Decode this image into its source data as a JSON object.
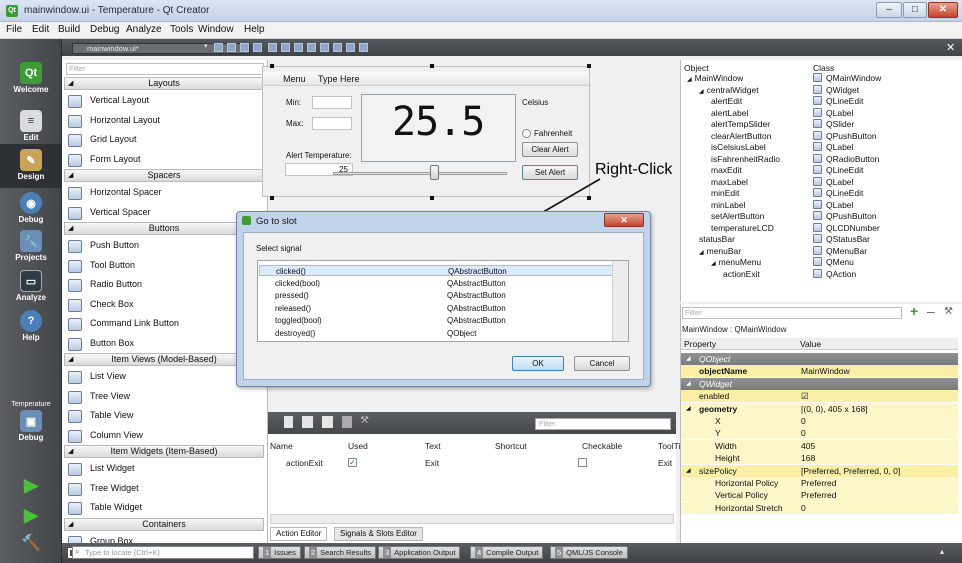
{
  "window": {
    "title": "mainwindow.ui - Temperature - Qt Creator",
    "icon": "qt-creator-icon"
  },
  "menubar": [
    "File",
    "Edit",
    "Build",
    "Debug",
    "Analyze",
    "Tools",
    "Window",
    "Help"
  ],
  "modes": [
    {
      "label": "Welcome",
      "icon": "qt-logo-icon"
    },
    {
      "label": "Edit",
      "icon": "edit-document-icon"
    },
    {
      "label": "Design",
      "icon": "design-pen-icon"
    },
    {
      "label": "Debug",
      "icon": "debug-icon"
    },
    {
      "label": "Projects",
      "icon": "projects-wrench-icon"
    },
    {
      "label": "Analyze",
      "icon": "analyze-monitor-icon"
    },
    {
      "label": "Help",
      "icon": "help-icon"
    },
    {
      "label": "Temperature",
      "icon": "kit-selector-icon"
    },
    {
      "label": "Debug",
      "icon": "build-config-icon"
    }
  ],
  "editor": {
    "file": "mainwindow.ui*"
  },
  "widgetbox": {
    "filter_placeholder": "Filter",
    "sections": [
      {
        "title": "Layouts",
        "items": [
          "Vertical Layout",
          "Horizontal Layout",
          "Grid Layout",
          "Form Layout"
        ]
      },
      {
        "title": "Spacers",
        "items": [
          "Horizontal Spacer",
          "Vertical Spacer"
        ]
      },
      {
        "title": "Buttons",
        "items": [
          "Push Button",
          "Tool Button",
          "Radio Button",
          "Check Box",
          "Command Link Button",
          "Button Box"
        ]
      },
      {
        "title": "Item Views (Model-Based)",
        "items": [
          "List View",
          "Tree View",
          "Table View",
          "Column View"
        ]
      },
      {
        "title": "Item Widgets (Item-Based)",
        "items": [
          "List Widget",
          "Tree Widget",
          "Table Widget"
        ]
      },
      {
        "title": "Containers",
        "items": [
          "Group Box",
          "Scroll Area"
        ]
      }
    ]
  },
  "form": {
    "menu": [
      "Menu",
      "Type Here"
    ],
    "min_label": "Min:",
    "max_label": "Max:",
    "alert_label": "Alert Temperature:",
    "alert_value": "25",
    "lcd_value": "25.5",
    "celsius_label": "Celsius",
    "fahrenheit_label": "Fahrenheit",
    "clear_alert": "Clear Alert",
    "set_alert": "Set Alert",
    "slider_fraction": 0.58
  },
  "callout": "Right-Click",
  "dialog": {
    "title": "Go to slot",
    "select_signal": "Select signal",
    "signals": [
      {
        "name": "clicked()",
        "class": "QAbstractButton",
        "selected": true
      },
      {
        "name": "clicked(bool)",
        "class": "QAbstractButton"
      },
      {
        "name": "pressed()",
        "class": "QAbstractButton"
      },
      {
        "name": "released()",
        "class": "QAbstractButton"
      },
      {
        "name": "toggled(bool)",
        "class": "QAbstractButton"
      },
      {
        "name": "destroyed()",
        "class": "QObject"
      }
    ],
    "ok": "OK",
    "cancel": "Cancel"
  },
  "action_editor": {
    "filter_placeholder": "Filter",
    "headers": [
      "Name",
      "Used",
      "Text",
      "Shortcut",
      "Checkable",
      "ToolTi"
    ],
    "rows": [
      {
        "name": "actionExit",
        "used": true,
        "text": "Exit",
        "shortcut": "",
        "checkable": false,
        "tooltip": "Exit"
      }
    ],
    "tabs": [
      "Action Editor",
      "Signals & Slots Editor"
    ]
  },
  "object_inspector": {
    "headers": [
      "Object",
      "Class"
    ],
    "rows": [
      {
        "name": "MainWindow",
        "class": "QMainWindow",
        "depth": 0,
        "expand": true
      },
      {
        "name": "centralWidget",
        "class": "QWidget",
        "depth": 1,
        "expand": true
      },
      {
        "name": "alertEdit",
        "class": "QLineEdit",
        "depth": 2
      },
      {
        "name": "alertLabel",
        "class": "QLabel",
        "depth": 2
      },
      {
        "name": "alertTempSlider",
        "class": "QSlider",
        "depth": 2
      },
      {
        "name": "clearAlertButton",
        "class": "QPushButton",
        "depth": 2
      },
      {
        "name": "isCelsiusLabel",
        "class": "QLabel",
        "depth": 2
      },
      {
        "name": "isFahrenheitRadio",
        "class": "QRadioButton",
        "depth": 2
      },
      {
        "name": "maxEdit",
        "class": "QLineEdit",
        "depth": 2
      },
      {
        "name": "maxLabel",
        "class": "QLabel",
        "depth": 2
      },
      {
        "name": "minEdit",
        "class": "QLineEdit",
        "depth": 2
      },
      {
        "name": "minLabel",
        "class": "QLabel",
        "depth": 2
      },
      {
        "name": "setAlertButton",
        "class": "QPushButton",
        "depth": 2
      },
      {
        "name": "temperatureLCD",
        "class": "QLCDNumber",
        "depth": 2
      },
      {
        "name": "statusBar",
        "class": "QStatusBar",
        "depth": 1
      },
      {
        "name": "menuBar",
        "class": "QMenuBar",
        "depth": 1,
        "expand": true
      },
      {
        "name": "menuMenu",
        "class": "QMenu",
        "depth": 2,
        "expand": true
      },
      {
        "name": "actionExit",
        "class": "QAction",
        "depth": 3
      }
    ]
  },
  "property_editor": {
    "filter_placeholder": "Filter",
    "title": "MainWindow : QMainWindow",
    "headers": [
      "Property",
      "Value"
    ],
    "rows": [
      {
        "type": "group",
        "key": "QObject"
      },
      {
        "type": "prop",
        "key": "objectName",
        "value": "MainWindow",
        "bold": true
      },
      {
        "type": "group",
        "key": "QWidget"
      },
      {
        "type": "prop",
        "key": "enabled",
        "value": "☑"
      },
      {
        "type": "prop",
        "key": "geometry",
        "value": "[(0, 0), 405 x 168]",
        "bold": true,
        "expand": true
      },
      {
        "type": "sub",
        "key": "X",
        "value": "0"
      },
      {
        "type": "sub",
        "key": "Y",
        "value": "0"
      },
      {
        "type": "sub",
        "key": "Width",
        "value": "405"
      },
      {
        "type": "sub",
        "key": "Height",
        "value": "168"
      },
      {
        "type": "prop",
        "key": "sizePolicy",
        "value": "[Preferred, Preferred, 0, 0]",
        "expand": true
      },
      {
        "type": "sub",
        "key": "Horizontal Policy",
        "value": "Preferred"
      },
      {
        "type": "sub",
        "key": "Vertical Policy",
        "value": "Preferred"
      },
      {
        "type": "sub",
        "key": "Horizontal Stretch",
        "value": "0"
      }
    ]
  },
  "statusbar": {
    "locator_placeholder": "Type to locate (Ctrl+K)",
    "panes": [
      {
        "n": "1",
        "label": "Issues"
      },
      {
        "n": "2",
        "label": "Search Results"
      },
      {
        "n": "3",
        "label": "Application Output"
      },
      {
        "n": "4",
        "label": "Compile Output"
      },
      {
        "n": "5",
        "label": "QML/JS Console"
      }
    ]
  },
  "colors": {
    "qt_green": "#3d9b35",
    "selection": "#dceafc",
    "sidebar": "#4a4e52",
    "group_header": "#888888",
    "prop_yellow": "#fdf6c9"
  }
}
